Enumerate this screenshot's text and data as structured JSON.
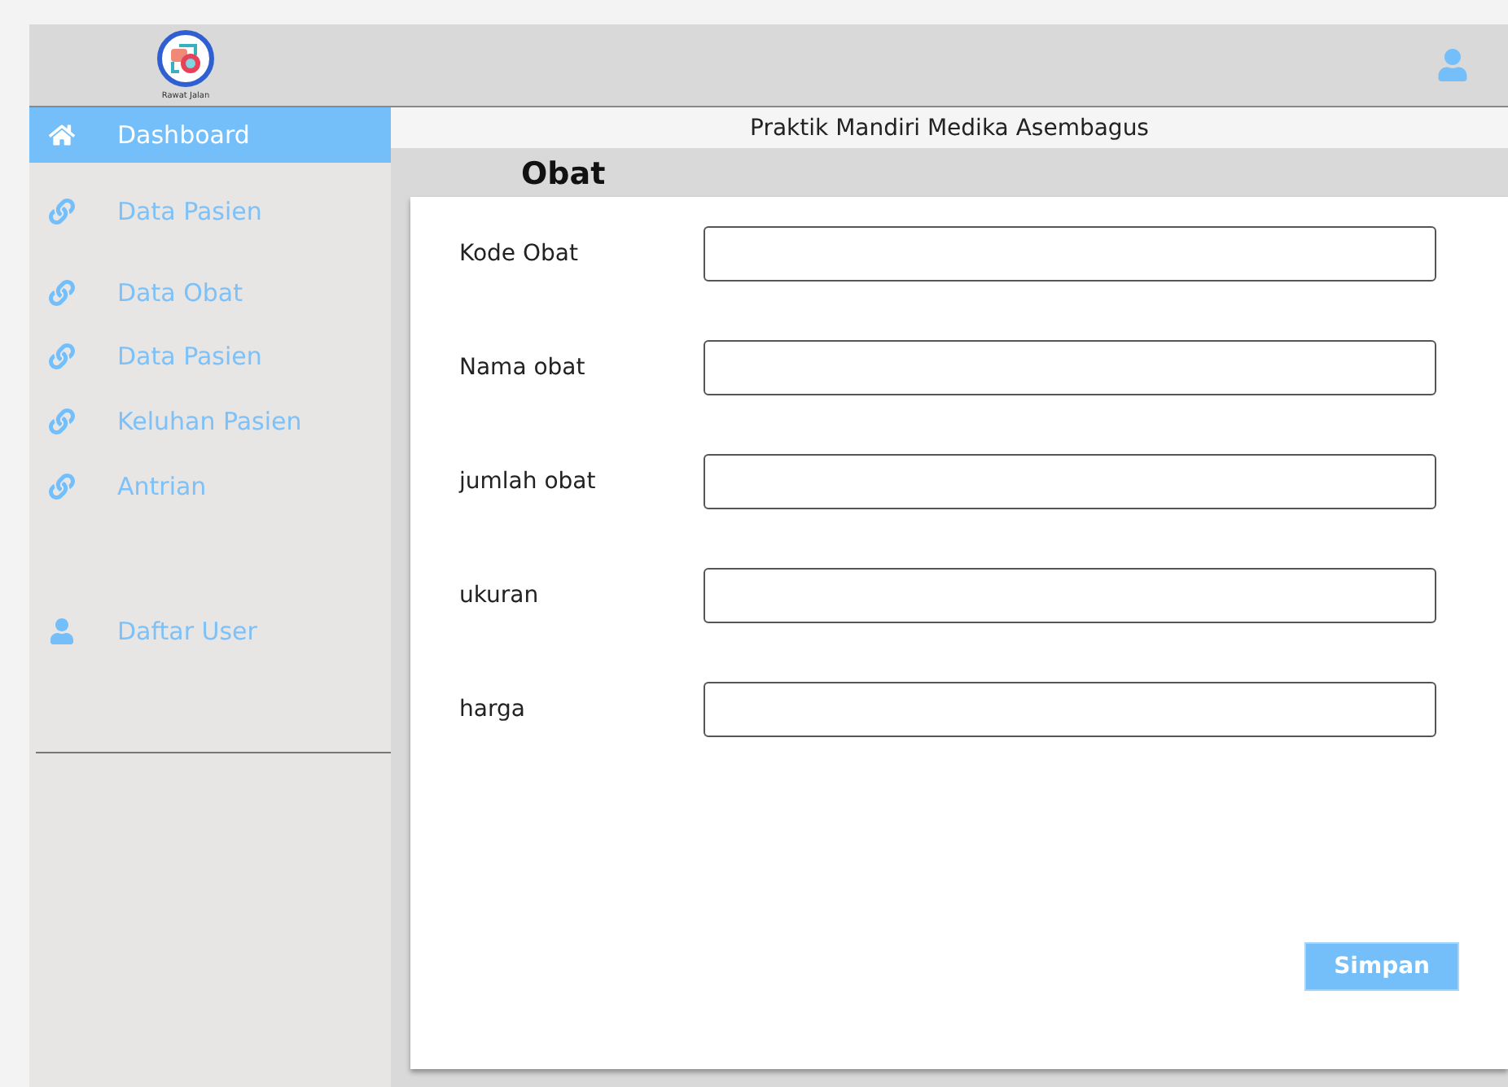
{
  "header": {
    "logo_caption": "Rawat Jalan"
  },
  "sidebar": {
    "items": [
      {
        "label": "Dashboard",
        "kind": "home",
        "selected": true
      },
      {
        "label": "Data Pasien",
        "kind": "link",
        "selected": false
      },
      {
        "label": "Data Obat",
        "kind": "link",
        "selected": false
      },
      {
        "label": "Data Pasien",
        "kind": "link",
        "selected": false
      },
      {
        "label": "Keluhan Pasien",
        "kind": "link",
        "selected": false
      },
      {
        "label": "Antrian",
        "kind": "link",
        "selected": false
      },
      {
        "label": "Daftar User",
        "kind": "user",
        "selected": false
      }
    ]
  },
  "main": {
    "title": "Praktik Mandiri Medika Asembagus",
    "section": "Obat",
    "fields": [
      {
        "label": "Kode Obat"
      },
      {
        "label": "Nama obat"
      },
      {
        "label": "jumlah obat"
      },
      {
        "label": "ukuran"
      },
      {
        "label": "harga"
      }
    ],
    "submit": "Simpan"
  }
}
